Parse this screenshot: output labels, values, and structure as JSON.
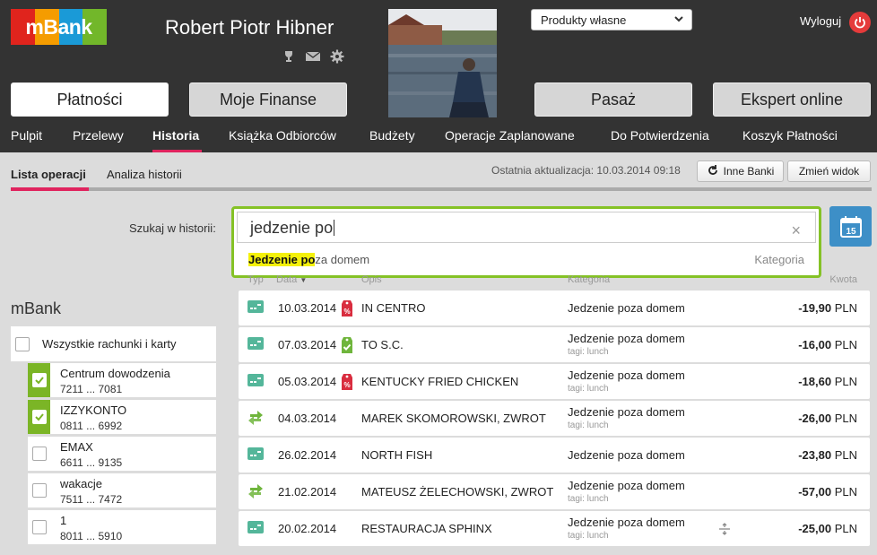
{
  "brand": {
    "name": "mBank",
    "logo_colors": [
      "#e0241d",
      "#f59c00",
      "#1a9ad7",
      "#72b72a"
    ]
  },
  "header": {
    "user_name": "Robert Piotr Hibner",
    "icons": [
      "trophy-icon",
      "mail-icon",
      "gear-icon"
    ],
    "products_select": "Produkty własne",
    "logout_label": "Wyloguj",
    "main_buttons": [
      "Płatności",
      "Moje Finanse",
      "Pasaż",
      "Ekspert online"
    ]
  },
  "subnav": {
    "items": [
      "Pulpit",
      "Przelewy",
      "Historia",
      "Książka Odbiorców",
      "Budżety",
      "Operacje Zaplanowane",
      "Do Potwierdzenia",
      "Koszyk Płatności"
    ],
    "active": "Historia"
  },
  "tabs": {
    "items": [
      "Lista operacji",
      "Analiza historii"
    ],
    "active": "Lista operacji",
    "last_update": "Ostatnia aktualizacja: 10.03.2014 09:18",
    "other_banks_label": "Inne Banki",
    "change_view_label": "Zmień widok"
  },
  "search": {
    "label": "Szukaj w historii:",
    "value": "jedzenie po",
    "suggestion_match": "Jedzenie po",
    "suggestion_rest": "za domem",
    "suggestion_type": "Kategoria",
    "calendar_day": "15"
  },
  "columns": {
    "type": "Typ",
    "date": "Data",
    "description": "Opis",
    "category": "Kategoria",
    "amount": "Kwota"
  },
  "accounts": {
    "title": "mBank",
    "all_label": "Wszystkie rachunki i karty",
    "items": [
      {
        "name": "Centrum dowodzenia",
        "number": "7211 ... 7081",
        "checked": true
      },
      {
        "name": "IZZYKONTO",
        "number": "0811 ... 6992",
        "checked": true
      },
      {
        "name": "EMAX",
        "number": "6611 ... 9135",
        "checked": false
      },
      {
        "name": "wakacje",
        "number": "7511 ... 7472",
        "checked": false
      },
      {
        "name": "1",
        "number": "8011 ... 5910",
        "checked": false
      }
    ]
  },
  "transactions": [
    {
      "date": "10.03.2014",
      "badge": "percent-tag-icon",
      "description": "IN CENTRO",
      "category": "Jedzenie poza domem",
      "tags": "",
      "amount": "-19,90",
      "currency": "PLN",
      "type": "card-icon"
    },
    {
      "date": "07.03.2014",
      "badge": "check-tag-icon",
      "description": "TO S.C.",
      "category": "Jedzenie poza domem",
      "tags": "tagi: lunch",
      "amount": "-16,00",
      "currency": "PLN",
      "type": "card-icon"
    },
    {
      "date": "05.03.2014",
      "badge": "percent-tag-icon",
      "description": "KENTUCKY FRIED CHICKEN",
      "category": "Jedzenie poza domem",
      "tags": "tagi: lunch",
      "amount": "-18,60",
      "currency": "PLN",
      "type": "card-icon"
    },
    {
      "date": "04.03.2014",
      "badge": "",
      "description": "MAREK SKOMOROWSKI, ZWROT",
      "category": "Jedzenie poza domem",
      "tags": "tagi: lunch",
      "amount": "-26,00",
      "currency": "PLN",
      "type": "transfer-icon"
    },
    {
      "date": "26.02.2014",
      "badge": "",
      "description": "NORTH FISH",
      "category": "Jedzenie poza domem",
      "tags": "",
      "amount": "-23,80",
      "currency": "PLN",
      "type": "card-icon"
    },
    {
      "date": "21.02.2014",
      "badge": "",
      "description": "MATEUSZ ŻELECHOWSKI, ZWROT",
      "category": "Jedzenie poza domem",
      "tags": "tagi: lunch",
      "amount": "-57,00",
      "currency": "PLN",
      "type": "transfer-icon"
    },
    {
      "date": "20.02.2014",
      "badge": "",
      "description": "RESTAURACJA SPHINX",
      "category": "Jedzenie poza domem",
      "tags": "tagi: lunch",
      "amount": "-25,00",
      "currency": "PLN",
      "type": "card-icon",
      "split": true
    }
  ]
}
